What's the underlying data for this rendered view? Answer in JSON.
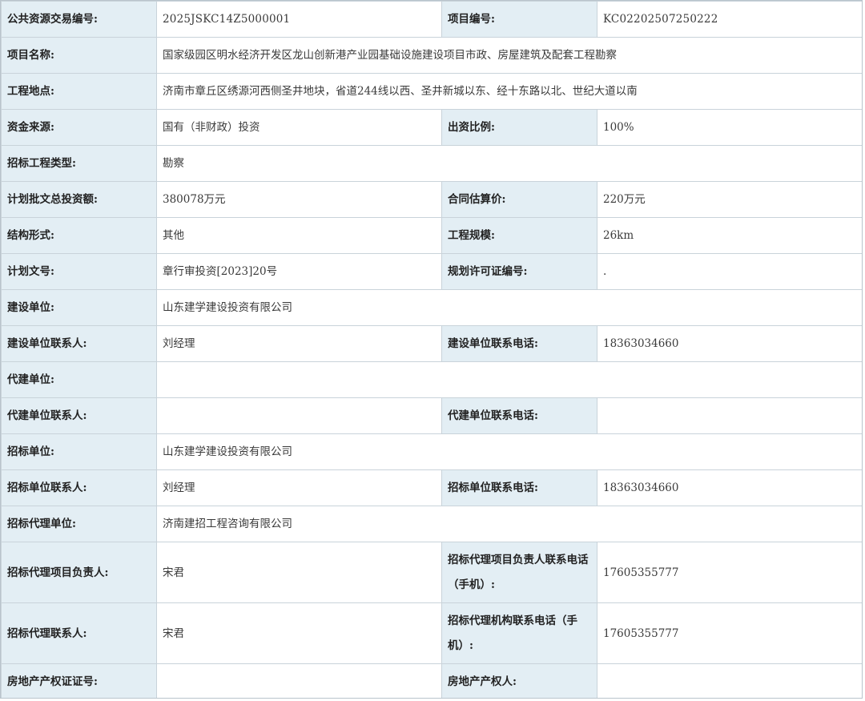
{
  "rows": [
    {
      "l1": "公共资源交易编号:",
      "v1": "2025JSKC14Z5000001",
      "l2": "项目编号:",
      "v2": "KC02202507250222"
    },
    {
      "l1": "项目名称:",
      "v1": "国家级园区明水经济开发区龙山创新港产业园基础设施建设项目市政、房屋建筑及配套工程勘察"
    },
    {
      "l1": "工程地点:",
      "v1": "济南市章丘区绣源河西侧圣井地块，省道244线以西、圣井新城以东、经十东路以北、世纪大道以南"
    },
    {
      "l1": "资金来源:",
      "v1": "国有（非财政）投资",
      "l2": "出资比例:",
      "v2": "100%"
    },
    {
      "l1": "招标工程类型:",
      "v1": "勘察"
    },
    {
      "l1": "计划批文总投资额:",
      "v1": "380078万元",
      "l2": "合同估算价:",
      "v2": "220万元"
    },
    {
      "l1": "结构形式:",
      "v1": "其他",
      "l2": "工程规模:",
      "v2": "26km"
    },
    {
      "l1": "计划文号:",
      "v1": "章行审投资[2023]20号",
      "l2": "规划许可证编号:",
      "v2": "."
    },
    {
      "l1": "建设单位:",
      "v1": "山东建学建设投资有限公司"
    },
    {
      "l1": "建设单位联系人:",
      "v1": "刘经理",
      "l2": "建设单位联系电话:",
      "v2": "18363034660"
    },
    {
      "l1": "代建单位:",
      "v1": ""
    },
    {
      "l1": "代建单位联系人:",
      "v1": "",
      "l2": "代建单位联系电话:",
      "v2": ""
    },
    {
      "l1": "招标单位:",
      "v1": "山东建学建设投资有限公司"
    },
    {
      "l1": "招标单位联系人:",
      "v1": "刘经理",
      "l2": "招标单位联系电话:",
      "v2": "18363034660"
    },
    {
      "l1": "招标代理单位:",
      "v1": "济南建招工程咨询有限公司"
    },
    {
      "l1": "招标代理项目负责人:",
      "v1": "宋君",
      "l2": "招标代理项目负责人联系电话（手机）:",
      "v2": "17605355777"
    },
    {
      "l1": "招标代理联系人:",
      "v1": "宋君",
      "l2": "招标代理机构联系电话（手机）:",
      "v2": "17605355777"
    },
    {
      "l1": "房地产产权证证号:",
      "v1": "",
      "l2": "房地产产权人:",
      "v2": ""
    }
  ]
}
